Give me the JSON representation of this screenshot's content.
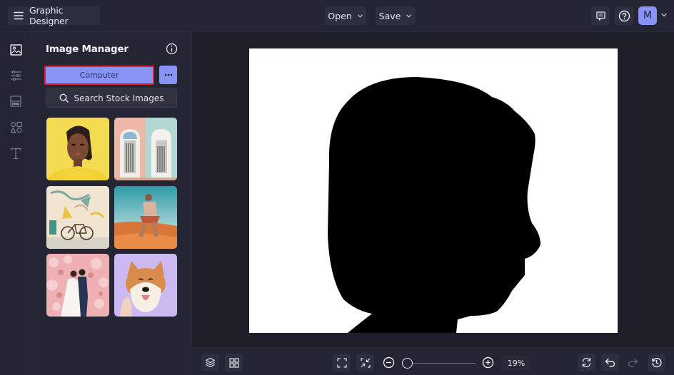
{
  "topbar": {
    "app_title": "Graphic Designer",
    "open_label": "Open",
    "save_label": "Save",
    "avatar_initial": "M",
    "icons": [
      "hamburger-menu-icon",
      "chevron-down-icon",
      "feedback-icon",
      "help-icon"
    ]
  },
  "iconrail": {
    "items": [
      {
        "name": "image-manager",
        "icon": "image-icon",
        "active": true
      },
      {
        "name": "adjustments",
        "icon": "sliders-icon",
        "active": false
      },
      {
        "name": "layout",
        "icon": "layout-icon",
        "active": false
      },
      {
        "name": "graphics",
        "icon": "shapes-icon",
        "active": false
      },
      {
        "name": "text",
        "icon": "text-icon",
        "active": false
      }
    ]
  },
  "panel": {
    "title": "Image Manager",
    "computer_label": "Computer",
    "search_stock_label": "Search Stock Images",
    "thumbnails": [
      {
        "subject": "woman on yellow background"
      },
      {
        "subject": "pastel doors"
      },
      {
        "subject": "bicycle in front of mural"
      },
      {
        "subject": "man sitting on sand"
      },
      {
        "subject": "couple under cherry blossoms"
      },
      {
        "subject": "shiba inu dog"
      }
    ]
  },
  "canvas": {
    "subject": "black head silhouette on white"
  },
  "bottombar": {
    "zoom_value": "19%",
    "zoom_level_percent": 19,
    "icons": [
      "layers-icon",
      "grid-icon",
      "fit-screen-icon",
      "shrink-icon",
      "zoom-out-icon",
      "zoom-in-icon",
      "reset-icon",
      "undo-icon",
      "redo-icon",
      "history-icon"
    ]
  },
  "colors": {
    "accent": "#8794f5",
    "highlight_border": "#e01e29",
    "background": "#232532",
    "canvas_bg": "#1d1e28"
  }
}
